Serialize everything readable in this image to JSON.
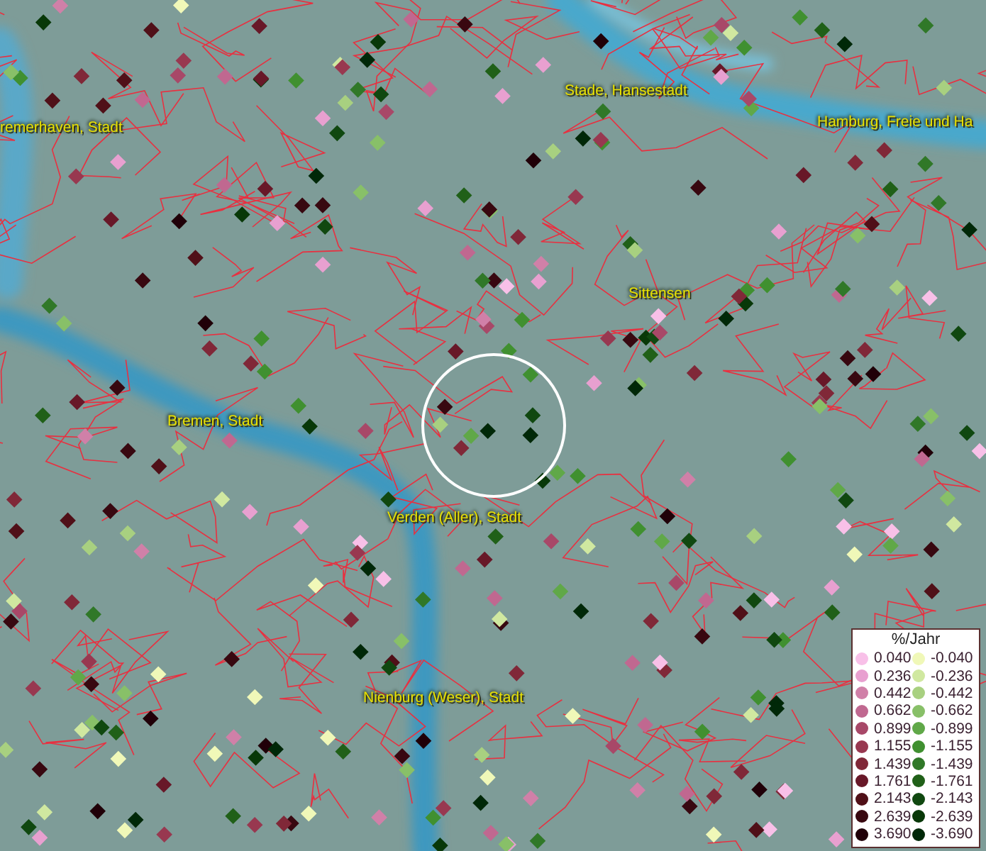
{
  "map": {
    "places": [
      {
        "label": "Stade, Hansestadt"
      },
      {
        "label": "remerhaven, Stadt"
      },
      {
        "label": "Hamburg, Freie und Ha"
      },
      {
        "label": "Sittensen"
      },
      {
        "label": "Bremen, Stadt"
      },
      {
        "label": "Verden (Aller), Stadt"
      },
      {
        "label": "Nienburg (Weser), Stadt"
      }
    ]
  },
  "legend": {
    "title": "%/Jahr",
    "rows": [
      {
        "left": {
          "label": "0.040",
          "color": "#f8c0e8"
        },
        "right": {
          "label": "-0.040",
          "color": "#f0f8b8"
        }
      },
      {
        "left": {
          "label": "0.236",
          "color": "#e8a0d0"
        },
        "right": {
          "label": "-0.236",
          "color": "#d0e8a0"
        }
      },
      {
        "left": {
          "label": "0.442",
          "color": "#d080a8"
        },
        "right": {
          "label": "-0.442",
          "color": "#a8d080"
        }
      },
      {
        "left": {
          "label": "0.662",
          "color": "#c06890"
        },
        "right": {
          "label": "-0.662",
          "color": "#88c068"
        }
      },
      {
        "left": {
          "label": "0.899",
          "color": "#a84868"
        },
        "right": {
          "label": "-0.899",
          "color": "#60a848"
        }
      },
      {
        "left": {
          "label": "1.155",
          "color": "#983850"
        },
        "right": {
          "label": "-1.155",
          "color": "#409030"
        }
      },
      {
        "left": {
          "label": "1.439",
          "color": "#802838"
        },
        "right": {
          "label": "-1.439",
          "color": "#307828"
        }
      },
      {
        "left": {
          "label": "1.761",
          "color": "#681828"
        },
        "right": {
          "label": "-1.761",
          "color": "#206018"
        }
      },
      {
        "left": {
          "label": "2.143",
          "color": "#501018"
        },
        "right": {
          "label": "-2.143",
          "color": "#104810"
        }
      },
      {
        "left": {
          "label": "2.639",
          "color": "#380810"
        },
        "right": {
          "label": "-2.639",
          "color": "#083808"
        }
      },
      {
        "left": {
          "label": "3.690",
          "color": "#200008"
        },
        "right": {
          "label": "-3.690",
          "color": "#002808"
        }
      }
    ]
  }
}
